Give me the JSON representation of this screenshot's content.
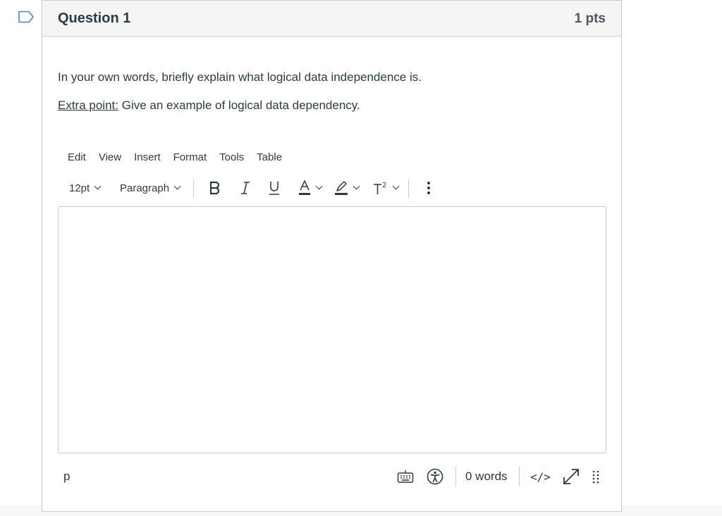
{
  "question": {
    "title": "Question 1",
    "points": "1 pts",
    "prompt": "In your own words, briefly explain what logical data independence is.",
    "extra_label": "Extra point:",
    "extra_text": " Give an example of logical data dependency."
  },
  "editor": {
    "menu": [
      "Edit",
      "View",
      "Insert",
      "Format",
      "Tools",
      "Table"
    ],
    "font_size": "12pt",
    "block_format": "Paragraph",
    "content": "",
    "status_path": "p",
    "word_count": "0 words",
    "html_toggle": "</>"
  },
  "icons": {
    "flag": "flag-icon",
    "bold": "bold-icon",
    "italic": "italic-icon",
    "underline": "underline-icon",
    "text_color": "text-color-icon",
    "highlight": "highlight-icon",
    "superscript": "superscript-icon",
    "more": "more-vertical-icon",
    "keyboard": "keyboard-icon",
    "accessibility": "accessibility-icon",
    "fullscreen": "fullscreen-icon",
    "resize": "resize-handle-icon"
  },
  "colors": {
    "text": "#2d3b45",
    "border": "#c7cdd1",
    "header_bg": "#f5f5f5",
    "flag": "#3b8ec4"
  }
}
